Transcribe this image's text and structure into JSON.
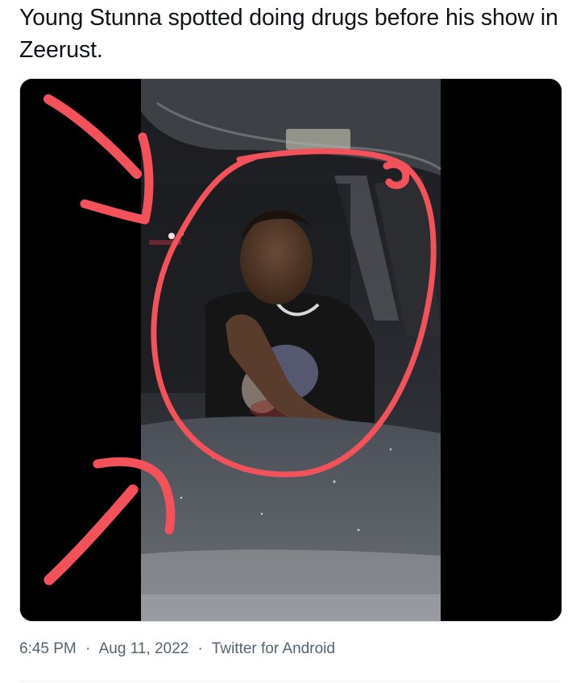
{
  "tweet": {
    "text": "Young Stunna spotted doing drugs before his show in Zeerust."
  },
  "media": {
    "type": "video-still",
    "alt_icon": "photo-icon",
    "annotation_color": "#f4525b",
    "annotations": [
      "red-circle-annotation",
      "red-arrow-annotation"
    ]
  },
  "meta": {
    "time": "6:45 PM",
    "separator": "·",
    "date": "Aug 11, 2022",
    "source": "Twitter for Android"
  },
  "colors": {
    "text_primary": "#0f1419",
    "text_secondary": "#536471",
    "border": "#cfd9de"
  }
}
